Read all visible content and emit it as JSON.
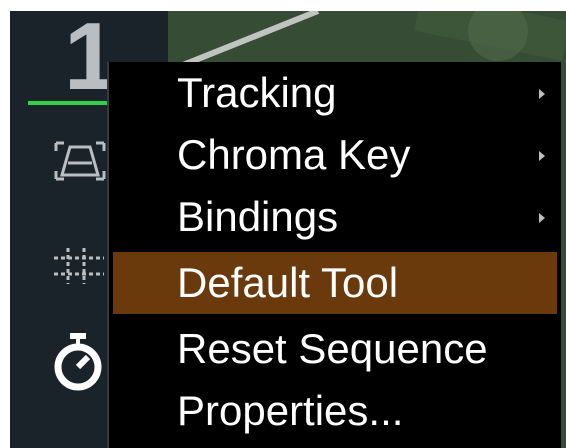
{
  "layer": {
    "number": "1"
  },
  "sidebar": {
    "icons": [
      "track-warp-icon",
      "grid-icon",
      "stopwatch-icon"
    ]
  },
  "context_menu": {
    "items": [
      {
        "label": "Tracking",
        "has_submenu": true,
        "highlighted": false
      },
      {
        "label": "Chroma Key",
        "has_submenu": true,
        "highlighted": false
      },
      {
        "label": "Bindings",
        "has_submenu": true,
        "highlighted": false
      },
      {
        "label": "Default Tool",
        "has_submenu": false,
        "highlighted": true
      },
      {
        "label": "Reset Sequence",
        "has_submenu": false,
        "highlighted": false
      },
      {
        "label": "Properties...",
        "has_submenu": false,
        "highlighted": false
      }
    ]
  },
  "colors": {
    "highlight": "#6a3a0d",
    "active_underline": "#2fd24a",
    "menu_bg": "#000000",
    "sidebar_bg": "#1a222a"
  }
}
